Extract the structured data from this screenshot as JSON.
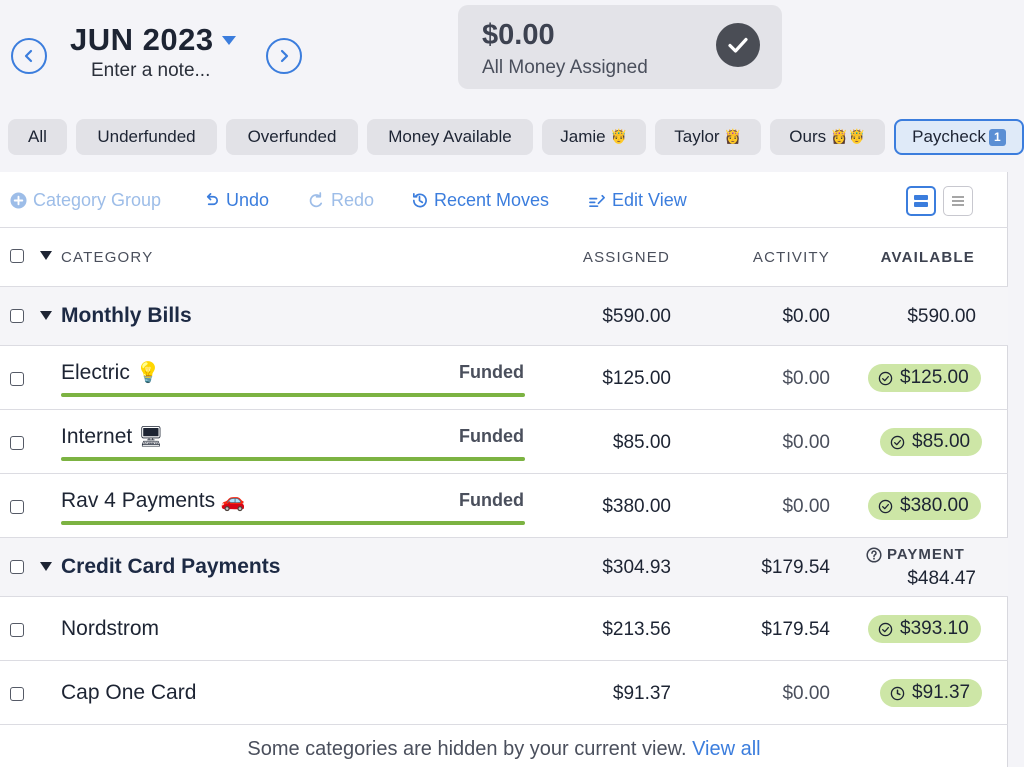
{
  "header": {
    "month": "JUN 2023",
    "note_placeholder": "Enter a note...",
    "assigned_amount": "$0.00",
    "assigned_label": "All Money Assigned"
  },
  "filters": [
    {
      "label": "All",
      "emoji": ""
    },
    {
      "label": "Underfunded",
      "emoji": ""
    },
    {
      "label": "Overfunded",
      "emoji": ""
    },
    {
      "label": "Money Available",
      "emoji": ""
    },
    {
      "label": "Jamie",
      "emoji": "🤴"
    },
    {
      "label": "Taylor",
      "emoji": "👸"
    },
    {
      "label": "Ours",
      "emoji": "👸🤴"
    },
    {
      "label": "Paycheck",
      "emoji": "",
      "badge": "1",
      "active": true
    }
  ],
  "toolbar": {
    "category_group": "Category Group",
    "undo": "Undo",
    "redo": "Redo",
    "recent_moves": "Recent Moves",
    "edit_view": "Edit View"
  },
  "columns": {
    "category": "CATEGORY",
    "assigned": "ASSIGNED",
    "activity": "ACTIVITY",
    "available": "AVAILABLE"
  },
  "groups": [
    {
      "name": "Monthly Bills",
      "assigned": "$590.00",
      "activity": "$0.00",
      "available": "$590.00",
      "categories": [
        {
          "name": "Electric",
          "emoji": "💡",
          "status": "Funded",
          "assigned": "$125.00",
          "activity": "$0.00",
          "available": "$125.00",
          "icon": "check-circle-icon"
        },
        {
          "name": "Internet",
          "emoji": "🖥",
          "status": "Funded",
          "assigned": "$85.00",
          "activity": "$0.00",
          "available": "$85.00",
          "icon": "check-circle-icon"
        },
        {
          "name": "Rav 4 Payments",
          "emoji": "🚗",
          "status": "Funded",
          "assigned": "$380.00",
          "activity": "$0.00",
          "available": "$380.00",
          "icon": "check-circle-icon"
        }
      ]
    },
    {
      "name": "Credit Card Payments",
      "assigned": "$304.93",
      "activity": "$179.54",
      "available_label": "PAYMENT",
      "available": "$484.47",
      "categories": [
        {
          "name": "Nordstrom",
          "emoji": "",
          "status": "",
          "assigned": "$213.56",
          "activity": "$179.54",
          "available": "$393.10",
          "icon": "check-circle-icon"
        },
        {
          "name": "Cap One Card",
          "emoji": "",
          "status": "",
          "assigned": "$91.37",
          "activity": "$0.00",
          "available": "$91.37",
          "icon": "clock-circle-icon"
        }
      ]
    }
  ],
  "footer": {
    "text": "Some categories are hidden by your current view.",
    "link": "View all"
  },
  "colors": {
    "accent": "#3b7ddd",
    "funded_bar": "#7cb342",
    "available_pill": "#cde6a6"
  }
}
